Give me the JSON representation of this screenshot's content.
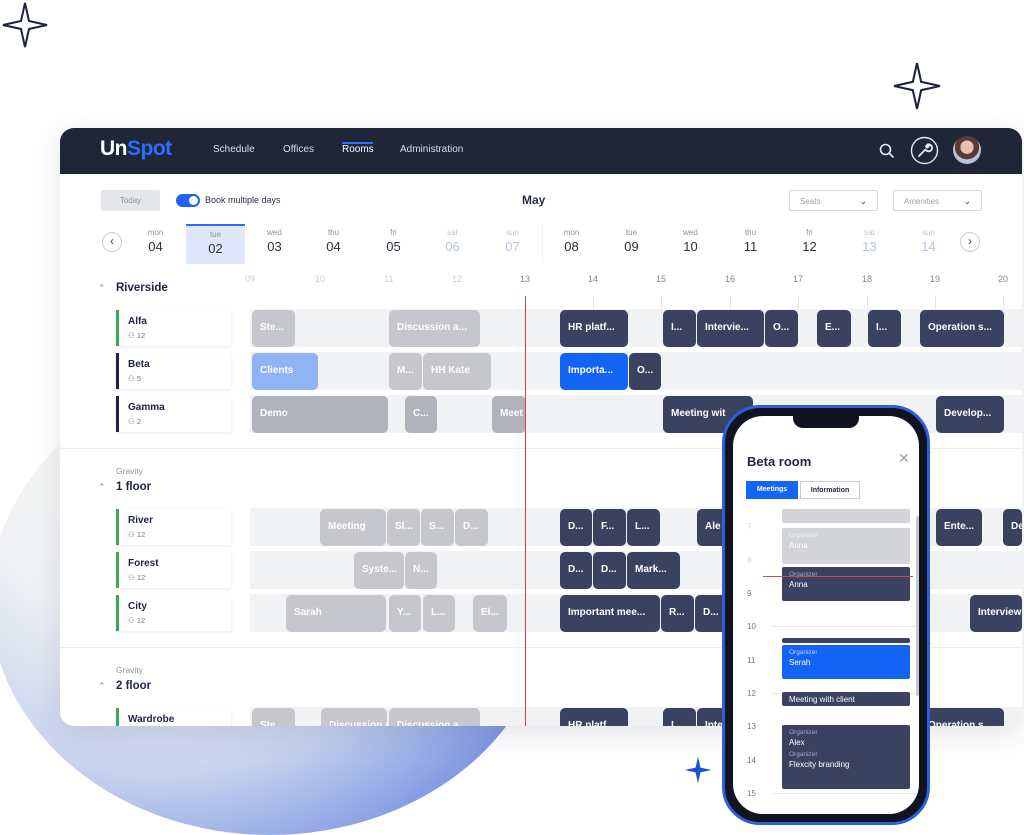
{
  "app": {
    "logo_un": "Un",
    "logo_spot": "Spot"
  },
  "nav": {
    "items": [
      "Schedule",
      "Offices",
      "Rooms",
      "Administration"
    ],
    "active": "Rooms"
  },
  "toolbar": {
    "today_label": "Today",
    "book_multiple_label": "Book multiple days",
    "book_multiple_on": true,
    "month": "May",
    "seats_placeholder": "Seats",
    "amenities_placeholder": "Amenities"
  },
  "days": [
    {
      "name": "mon",
      "num": "04"
    },
    {
      "name": "tue",
      "num": "02",
      "selected": true
    },
    {
      "name": "wed",
      "num": "03"
    },
    {
      "name": "thu",
      "num": "04"
    },
    {
      "name": "fri",
      "num": "05"
    },
    {
      "name": "sat",
      "num": "06",
      "weekend": true
    },
    {
      "name": "sun",
      "num": "07",
      "weekend": true
    },
    {
      "name": "mon",
      "num": "08"
    },
    {
      "name": "tue",
      "num": "09"
    },
    {
      "name": "wed",
      "num": "10"
    },
    {
      "name": "thu",
      "num": "11"
    },
    {
      "name": "fri",
      "num": "12"
    },
    {
      "name": "sat",
      "num": "13",
      "weekend": true
    },
    {
      "name": "sun",
      "num": "14",
      "weekend": true
    }
  ],
  "hours": [
    "09",
    "10",
    "11",
    "12",
    "13",
    "14",
    "15",
    "16",
    "17",
    "18",
    "19",
    "20"
  ],
  "sections": [
    {
      "title": "Riverside",
      "subtitle": "",
      "rooms": [
        {
          "name": "Alfa",
          "capacity": "12"
        },
        {
          "name": "Beta",
          "capacity": "5"
        },
        {
          "name": "Gamma",
          "capacity": "2"
        }
      ]
    },
    {
      "title": "1 floor",
      "subtitle": "Gravity",
      "rooms": [
        {
          "name": "River",
          "capacity": "12"
        },
        {
          "name": "Forest",
          "capacity": "12"
        },
        {
          "name": "City",
          "capacity": "12"
        }
      ]
    },
    {
      "title": "2 floor",
      "subtitle": "Gravity",
      "rooms": [
        {
          "name": "Wardrobe",
          "capacity": ""
        }
      ]
    }
  ],
  "events": {
    "alfa": [
      "Ste...",
      "Discussion a...",
      "HR platf...",
      "I...",
      "Intervie...",
      "O...",
      "E...",
      "I...",
      "Operation s..."
    ],
    "beta": [
      "Clients",
      "M...",
      "HH Kate",
      "Importa...",
      "O..."
    ],
    "gamma": [
      "Demo",
      "C...",
      "Meet",
      "Meeting wit",
      "Develop..."
    ],
    "river": [
      "Meeting",
      "Sl...",
      "S...",
      "D...",
      "D...",
      "F...",
      "L...",
      "Ale",
      "Ente...",
      "De"
    ],
    "forest": [
      "Syste...",
      "N...",
      "D...",
      "D...",
      "Mark..."
    ],
    "city": [
      "Sarah",
      "Y...",
      "L...",
      "El...",
      "Important mee...",
      "R...",
      "D...",
      "Interview"
    ],
    "wardrobe": [
      "Ste...",
      "Discussion a...",
      "Discussion a...",
      "HR platf...",
      "I...",
      "Inte",
      "Operation s..."
    ]
  },
  "mobile": {
    "title": "Beta room",
    "tab_meetings": "Meetings",
    "tab_information": "Information",
    "hours": [
      "7",
      "8",
      "9",
      "10",
      "11",
      "12",
      "13",
      "14",
      "15"
    ],
    "organizer_label": "Organizer",
    "events": [
      {
        "organizer": "Anna",
        "style": "grey"
      },
      {
        "organizer": "Anna",
        "style": "navy"
      },
      {
        "organizer": "Serah",
        "style": "blue"
      },
      {
        "title": "Meeting with client",
        "style": "navy"
      },
      {
        "organizer": "Alex",
        "subject": "Flexcity branding",
        "style": "navy"
      }
    ]
  },
  "colors": {
    "primary": "#1363f5",
    "navy": "#1f2638",
    "event_navy": "#394260",
    "now_line": "#e0404f",
    "available": "#3da55c"
  }
}
